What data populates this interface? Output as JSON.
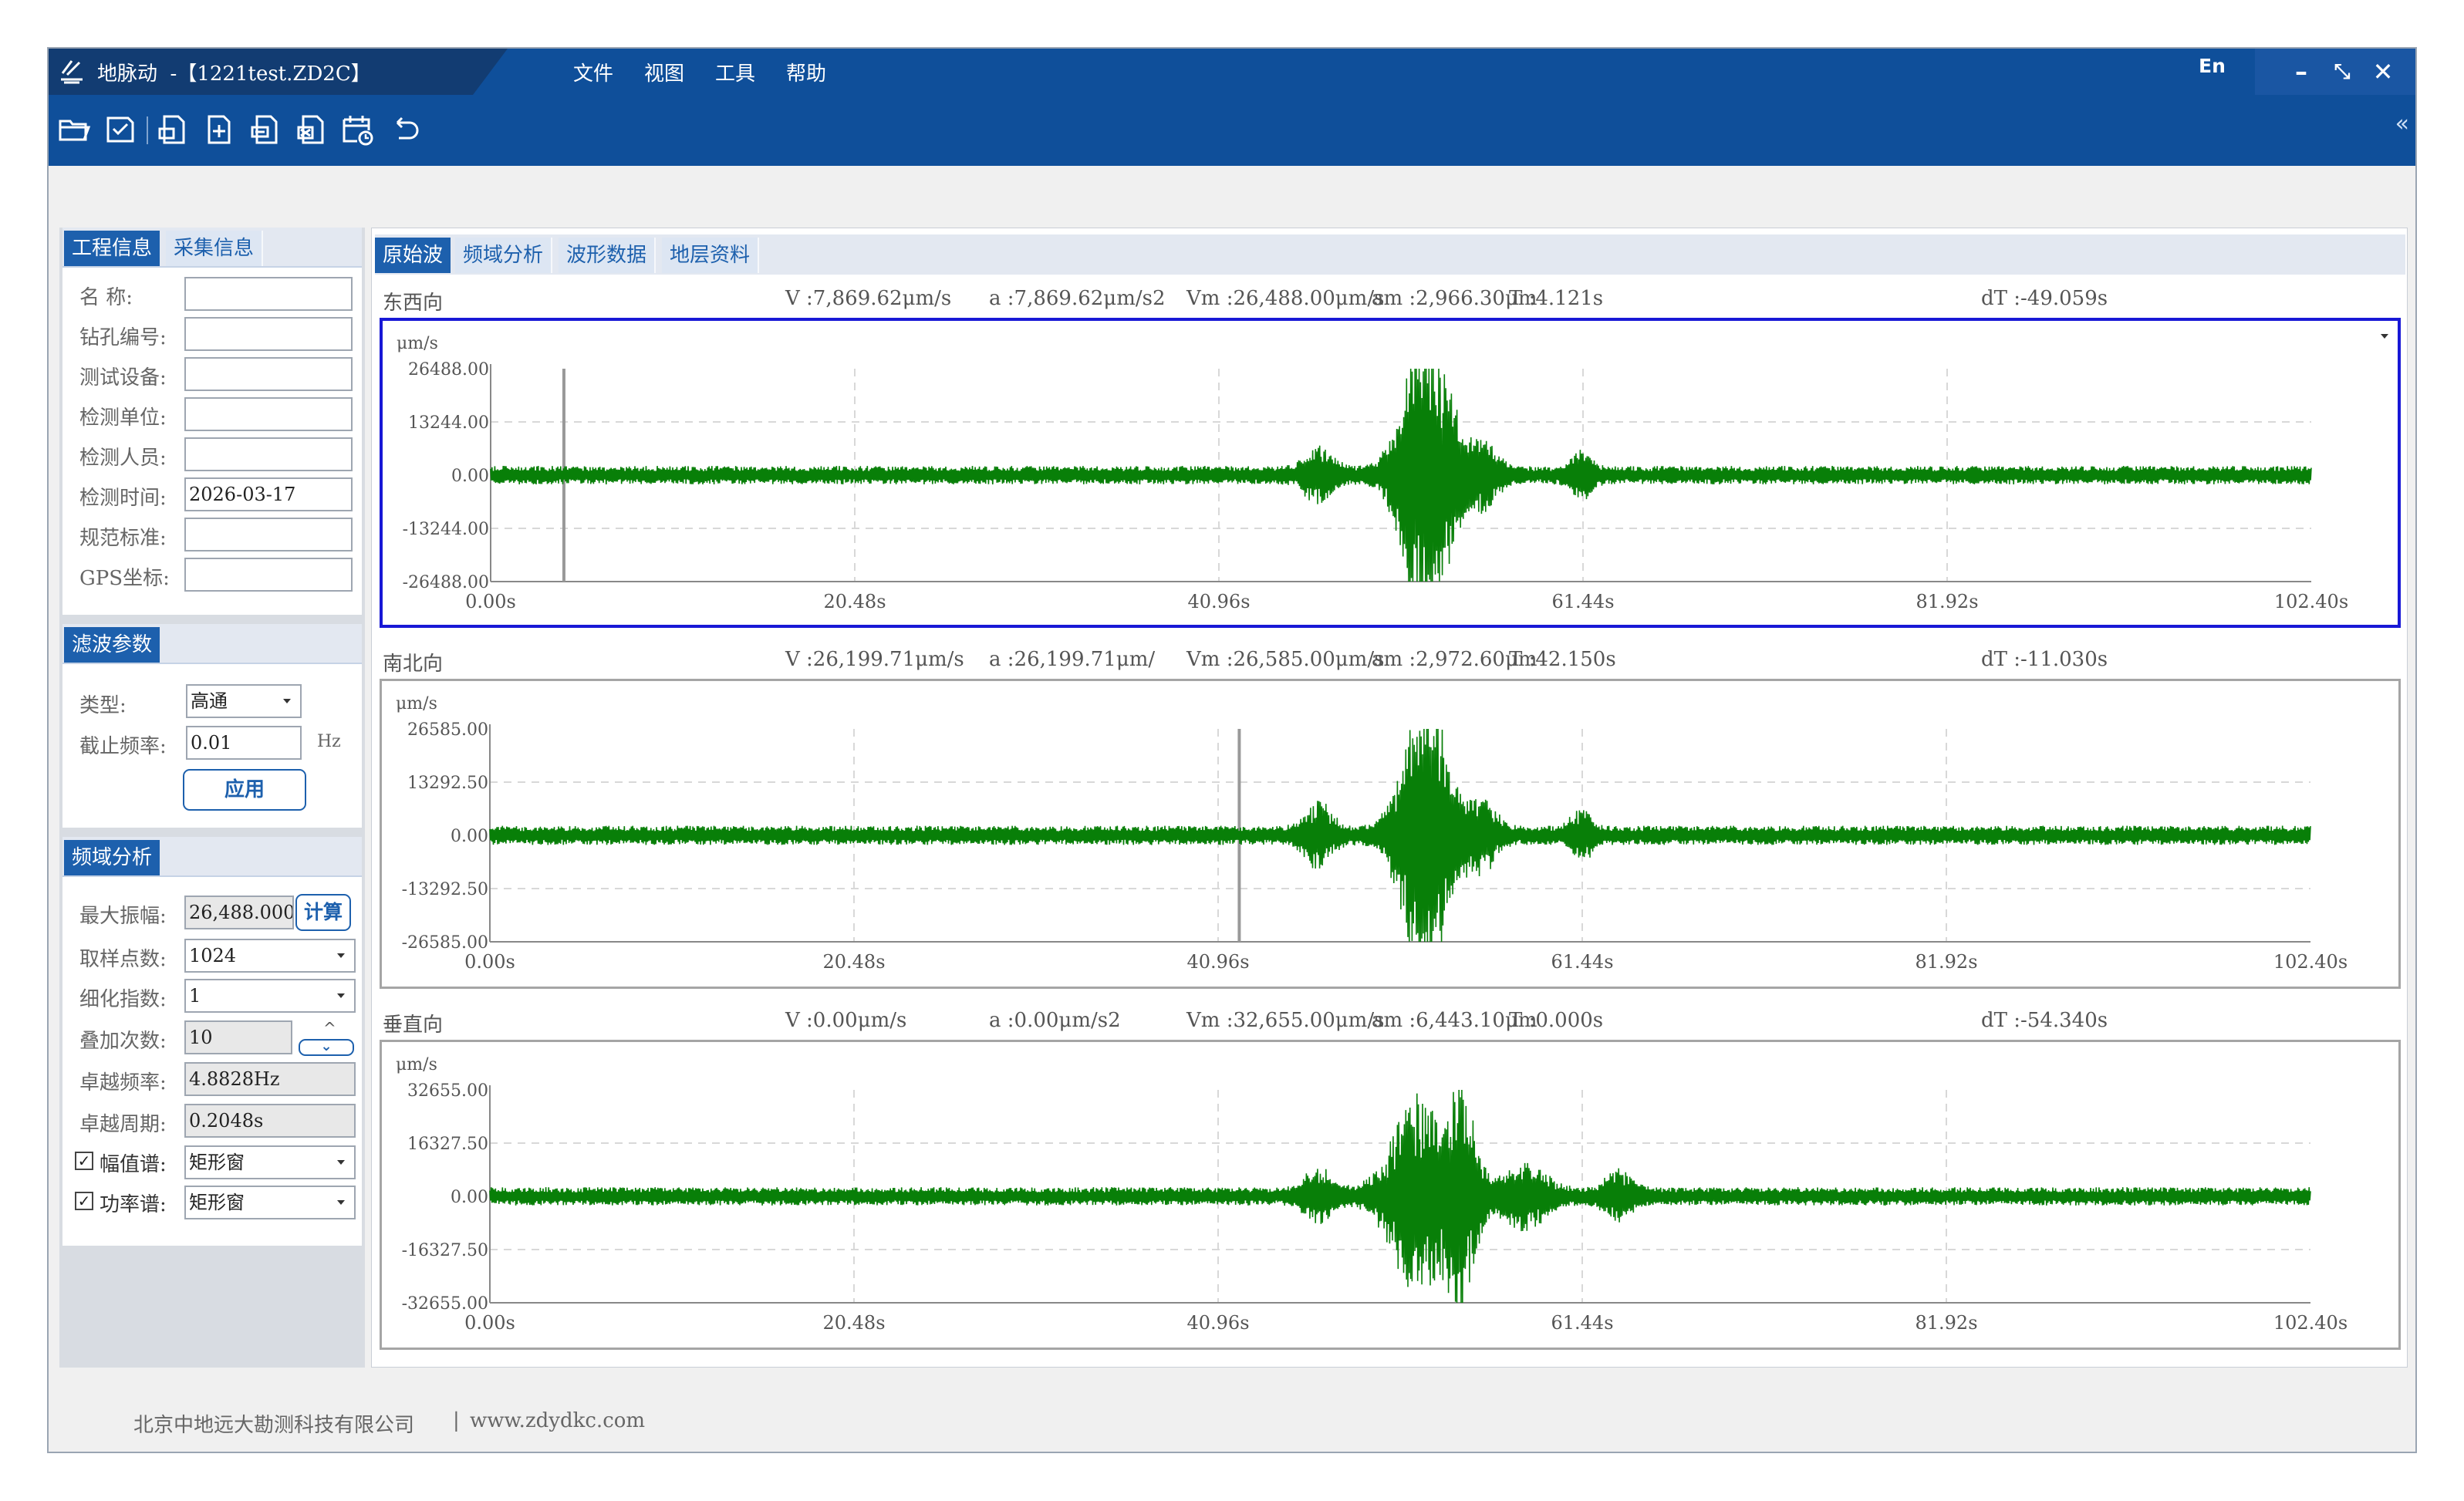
{
  "window": {
    "app_name": "地脉动",
    "file_title": "-【1221test.ZD2C】",
    "menu": [
      "文件",
      "视图",
      "工具",
      "帮助"
    ],
    "lang": "En",
    "collapse": "«"
  },
  "toolbar": {
    "icons": [
      "open-folder-icon",
      "save-icon",
      "export-icon",
      "add-icon",
      "report-icon",
      "excel-icon",
      "schedule-icon",
      "undo-icon"
    ]
  },
  "left": {
    "project_tabs": [
      "工程信息",
      "采集信息"
    ],
    "project_fields": [
      {
        "label": "名    称:",
        "value": ""
      },
      {
        "label": "钻孔编号:",
        "value": ""
      },
      {
        "label": "测试设备:",
        "value": ""
      },
      {
        "label": "检测单位:",
        "value": ""
      },
      {
        "label": "检测人员:",
        "value": ""
      },
      {
        "label": "检测时间:",
        "value": "2026-03-17"
      },
      {
        "label": "规范标准:",
        "value": ""
      },
      {
        "label": "GPS坐标:",
        "value": ""
      }
    ],
    "filter": {
      "title": "滤波参数",
      "type_label": "类型:",
      "type_value": "高通",
      "cutoff_label": "截止频率:",
      "cutoff_value": "0.01",
      "unit": "Hz",
      "apply": "应用"
    },
    "freq": {
      "title": "频域分析",
      "max_amp_label": "最大振幅:",
      "max_amp_value": "26,488.000",
      "calc": "计算",
      "samples_label": "取样点数:",
      "samples_value": "1024",
      "refine_label": "细化指数:",
      "refine_value": "1",
      "stack_label": "叠加次数:",
      "stack_value": "10",
      "pred_freq_label": "卓越频率:",
      "pred_freq_value": "4.8828Hz",
      "pred_period_label": "卓越周期:",
      "pred_period_value": "0.2048s",
      "amp_spec_label": "幅值谱:",
      "amp_spec_checked": "✓",
      "amp_spec_value": "矩形窗",
      "pow_spec_label": "功率谱:",
      "pow_spec_checked": "✓",
      "pow_spec_value": "矩形窗"
    }
  },
  "main": {
    "tabs": [
      "原始波",
      "频域分析",
      "波形数据",
      "地层资料"
    ]
  },
  "channels": [
    {
      "name": "东西向",
      "v": "V :7,869.62μm/s",
      "a": "a :7,869.62μm/s2",
      "vm": "Vm :26,488.00μm/s",
      "am": "am :2,966.30μm",
      "t": "T :4.121s",
      "dt": "dT :-49.059s"
    },
    {
      "name": "南北向",
      "v": "V :26,199.71μm/s",
      "a": "a :26,199.71μm/",
      "vm": "Vm :26,585.00μm/s",
      "am": "am :2,972.60μm",
      "t": "T :42.150s",
      "dt": "dT :-11.030s"
    },
    {
      "name": "垂直向",
      "v": "V :0.00μm/s",
      "a": "a :0.00μm/s2",
      "vm": "Vm :32,655.00μm/s",
      "am": "am :6,443.10μm",
      "t": "T :0.000s",
      "dt": "dT :-54.340s"
    }
  ],
  "footer": {
    "company": "北京中地远大勘测科技有限公司",
    "sep": "|",
    "site": "www.zdydkc.com"
  },
  "chart_data": [
    {
      "type": "line",
      "title": "东西向",
      "ylabel": "μm/s",
      "xlim": [
        0,
        102.4
      ],
      "ylim": [
        -26488,
        26488
      ],
      "x_ticks": [
        "0.00s",
        "20.48s",
        "40.96s",
        "61.44s",
        "81.92s",
        "102.40s"
      ],
      "y_ticks": [
        "26488.00",
        "13244.00",
        "0.00",
        "-13244.00",
        "-26488.00"
      ],
      "cursor_x": 4.121,
      "baseline_amplitude": 2300,
      "bursts": [
        [
          46.6,
          2,
          6000
        ],
        [
          52.2,
          3,
          24000
        ],
        [
          53.2,
          3,
          20000
        ],
        [
          55.8,
          2,
          8000
        ],
        [
          61.4,
          1.5,
          5000
        ]
      ],
      "color": "#087f08"
    },
    {
      "type": "line",
      "title": "南北向",
      "ylabel": "μm/s",
      "xlim": [
        0,
        102.4
      ],
      "ylim": [
        -26585,
        26585
      ],
      "x_ticks": [
        "0.00s",
        "20.48s",
        "40.96s",
        "61.44s",
        "81.92s",
        "102.40s"
      ],
      "y_ticks": [
        "26585.00",
        "13292.50",
        "0.00",
        "-13292.50",
        "-26585.00"
      ],
      "cursor_x": 42.15,
      "baseline_amplitude": 2400,
      "bursts": [
        [
          46.6,
          2,
          7000
        ],
        [
          52.2,
          3,
          24000
        ],
        [
          53.2,
          3,
          18000
        ],
        [
          55.8,
          2,
          8000
        ],
        [
          61.4,
          1.5,
          5000
        ]
      ],
      "color": "#087f08"
    },
    {
      "type": "line",
      "title": "垂直向",
      "ylabel": "μm/s",
      "xlim": [
        0,
        102.4
      ],
      "ylim": [
        -32655,
        32655
      ],
      "x_ticks": [
        "0.00s",
        "20.48s",
        "40.96s",
        "61.44s",
        "81.92s",
        "102.40s"
      ],
      "y_ticks": [
        "32655.00",
        "16327.50",
        "0.00",
        "-16327.50",
        "-32655.00"
      ],
      "cursor_x": null,
      "baseline_amplitude": 2800,
      "bursts": [
        [
          46.6,
          2,
          7000
        ],
        [
          52.3,
          4,
          31000
        ],
        [
          54.8,
          2,
          28000
        ],
        [
          58.2,
          3,
          9000
        ],
        [
          63.5,
          2,
          6000
        ]
      ],
      "color": "#087f08"
    }
  ]
}
